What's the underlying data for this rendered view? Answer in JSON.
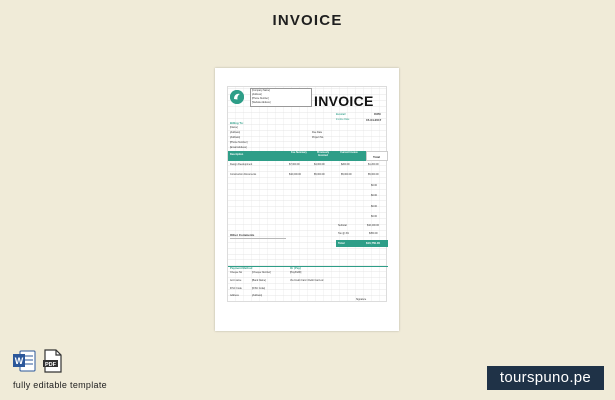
{
  "header": {
    "title": "INVOICE"
  },
  "invoice": {
    "company_lines": [
      "[Company Name]",
      "[Address]",
      "[Phone Number]",
      "[Website Address]"
    ],
    "title": "INVOICE",
    "invoice_label": "Invoice#",
    "invoice_value": "00456",
    "date_label": "Invoice Date",
    "date_value": "15-04-2017",
    "billing_to": "Billing To:",
    "billing_lines": [
      "[Name]",
      "[Address]",
      "[Address]",
      "[Phone Number]",
      "[Email Address]"
    ],
    "due_date_label": "Due Date",
    "po_label": "Project No.",
    "table_headers": [
      "Description",
      "Fee Summary",
      "Previously Invoiced",
      "Current Invoice",
      "Total"
    ],
    "rows": [
      {
        "desc": "Design Development",
        "fee": "$7,000.00",
        "prev": "$4,000.00",
        "curr": "$200.00",
        "total": "$1,200.00"
      },
      {
        "desc": "Construction Documents",
        "fee": "$10,000.00",
        "prev": "$5,000.00",
        "curr": "$5,000.00",
        "total": "$5,000.00"
      },
      {
        "desc": "",
        "fee": "",
        "prev": "",
        "curr": "",
        "total": "$0.00"
      },
      {
        "desc": "",
        "fee": "",
        "prev": "",
        "curr": "",
        "total": "$0.00"
      },
      {
        "desc": "",
        "fee": "",
        "prev": "",
        "curr": "",
        "total": "$0.00"
      },
      {
        "desc": "",
        "fee": "",
        "prev": "",
        "curr": "",
        "total": "$0.00"
      }
    ],
    "subtotal_label": "Subtotal",
    "subtotal_value": "$10,200.00",
    "tax_label": "Tax @ 4%",
    "tax_value": "$350.00",
    "other_comments": "Other Comments",
    "total_label": "Total",
    "total_value": "$10,750.00",
    "payment_method": "Payment Method",
    "pay_via": "Or (Pay)",
    "payment_lines": [
      {
        "label": "Cheque No",
        "value": "[Cheque Number]"
      },
      {
        "label": "Acct name",
        "value": "[Bank Name]"
      },
      {
        "label": "IFSC Code",
        "value": "[IFSC Code]"
      },
      {
        "label": "Address",
        "value": "[Address]"
      }
    ],
    "pay_lines": [
      "[PayPalID]",
      "Via Credit Card / Debit Card etc"
    ],
    "signature": "Signature"
  },
  "footer": {
    "caption": "fully editable template",
    "brand": "tourspuno.pe",
    "icons": [
      "word-doc-icon",
      "pdf-doc-icon"
    ],
    "colors": {
      "accent": "#2e9e88",
      "brand_bg": "#1f3247",
      "word_blue": "#2b579a"
    }
  }
}
